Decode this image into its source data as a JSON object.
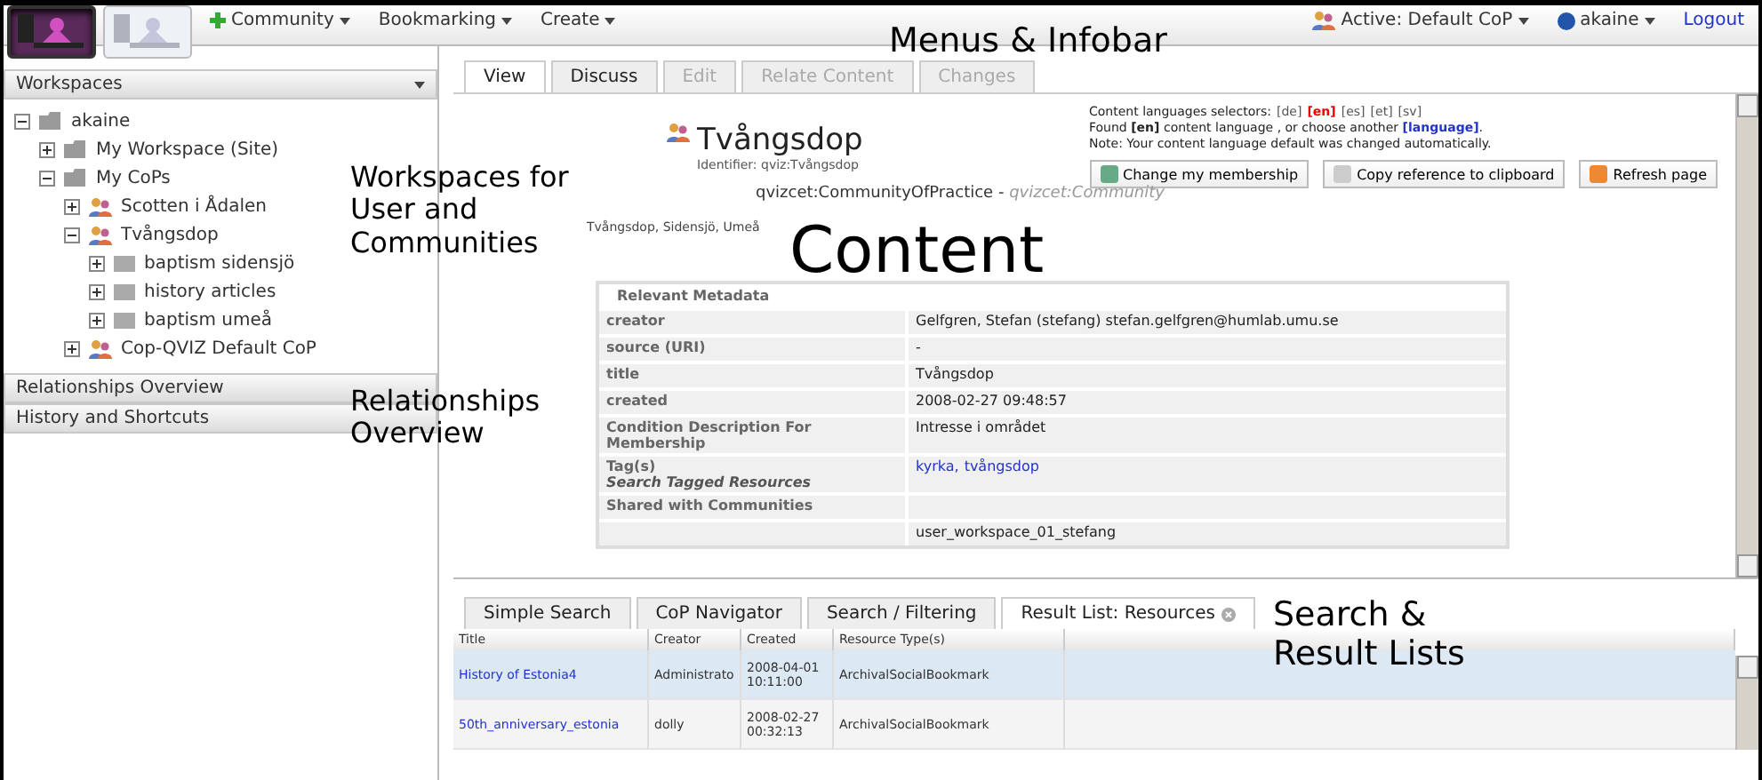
{
  "apps": [
    {
      "selected": true
    },
    {
      "selected": false
    }
  ],
  "menus": [
    "Community",
    "Bookmarking",
    "Create"
  ],
  "infobar": {
    "active": "Active: Default CoP",
    "user": "akaine",
    "logout": "Logout"
  },
  "sidebar": {
    "panels": [
      {
        "title": "Workspaces",
        "expanded": true
      },
      {
        "title": "Relationships Overview",
        "expanded": false
      },
      {
        "title": "History and Shortcuts",
        "expanded": false
      }
    ],
    "tree": [
      {
        "label": "akaine",
        "kind": "folder",
        "expanded": true,
        "children": [
          {
            "label": "My Workspace (Site)",
            "kind": "folder",
            "expanded": false
          },
          {
            "label": "My CoPs",
            "kind": "folder",
            "expanded": true,
            "children": [
              {
                "label": "Scotten i Ådalen",
                "kind": "community",
                "expanded": false
              },
              {
                "label": "Tvångsdop",
                "kind": "community",
                "expanded": true,
                "children": [
                  {
                    "label": "baptism sidensjö",
                    "kind": "resource",
                    "expanded": false
                  },
                  {
                    "label": "history articles",
                    "kind": "resource",
                    "expanded": false
                  },
                  {
                    "label": "baptism umeå",
                    "kind": "resource",
                    "expanded": false
                  }
                ]
              },
              {
                "label": "Cop-QVIZ Default CoP",
                "kind": "community",
                "expanded": false
              }
            ]
          }
        ]
      }
    ]
  },
  "content_tabs": [
    {
      "label": "View",
      "selected": true,
      "disabled": false
    },
    {
      "label": "Discuss",
      "selected": false,
      "disabled": false
    },
    {
      "label": "Edit",
      "selected": false,
      "disabled": true
    },
    {
      "label": "Relate Content",
      "selected": false,
      "disabled": true
    },
    {
      "label": "Changes",
      "selected": false,
      "disabled": true
    }
  ],
  "languages": {
    "label": "Content languages selectors:",
    "options": [
      {
        "code": "[de]",
        "selected": false
      },
      {
        "code": "[en]",
        "selected": true
      },
      {
        "code": "[es]",
        "selected": false
      },
      {
        "code": "[et]",
        "selected": false
      },
      {
        "code": "[sv]",
        "selected": false
      }
    ],
    "found": "Found **[en]** content language , or choose another",
    "choose": "[language]",
    "end": ".",
    "note": "Note: Your content language default was changed automatically."
  },
  "actions": [
    "Change my membership",
    "Copy reference to clipboard",
    "Refresh page"
  ],
  "page": {
    "title": "Tvångsdop",
    "identifier": "Identifier: qviz:Tvångsdop",
    "type": "qvizcet:CommunityOfPractice",
    "type_sep": " - ",
    "type_parent": "qvizcet:Community",
    "places": "Tvångsdop, Sidensjö, Umeå"
  },
  "metadata": {
    "heading": "Relevant Metadata",
    "rows": [
      {
        "label": "creator",
        "value": "Gelfgren, Stefan (stefang) stefan.gelfgren@humlab.umu.se"
      },
      {
        "label": "source (URI)",
        "value": "-"
      },
      {
        "label": "title",
        "value": "Tvångsdop"
      },
      {
        "label": "created",
        "value": "2008-02-27 09:48:57"
      },
      {
        "label": "Condition Description For Membership",
        "value": "Intresse i området"
      },
      {
        "label": "Tag(s)",
        "sublabel": "Search Tagged Resources",
        "links": [
          "kyrka,",
          "tvångsdop"
        ]
      },
      {
        "label": "Shared with Communities"
      },
      {
        "value": "user_workspace_01_stefang"
      }
    ]
  },
  "search_tabs": [
    {
      "label": "Simple Search",
      "selected": false,
      "closable": false
    },
    {
      "label": "CoP Navigator",
      "selected": false,
      "closable": false
    },
    {
      "label": "Search / Filtering",
      "selected": false,
      "closable": false
    },
    {
      "label": "Result List: Resources",
      "selected": true,
      "closable": true
    }
  ],
  "results": {
    "columns": [
      "Title",
      "Creator",
      "Created",
      "Resource Type(s)"
    ],
    "rows": [
      {
        "selected": true,
        "cells": [
          "History of Estonia4",
          "Administrato",
          "2008-04-01 10:11:00",
          "ArchivalSocialBookmark"
        ]
      },
      {
        "selected": false,
        "cells": [
          "50th_anniversary_estonia",
          "dolly",
          "2008-02-27 00:32:13",
          "ArchivalSocialBookmark"
        ]
      }
    ]
  },
  "annotations": [
    {
      "text": "Menus & Infobar",
      "kind": "menus"
    },
    {
      "text": "Workspaces for User and Communities",
      "kind": "workspaces"
    },
    {
      "text": "Content",
      "kind": "content"
    },
    {
      "text": "Relationships Overview",
      "kind": "relationships"
    },
    {
      "text": "Search & Result Lists",
      "kind": "search"
    }
  ]
}
